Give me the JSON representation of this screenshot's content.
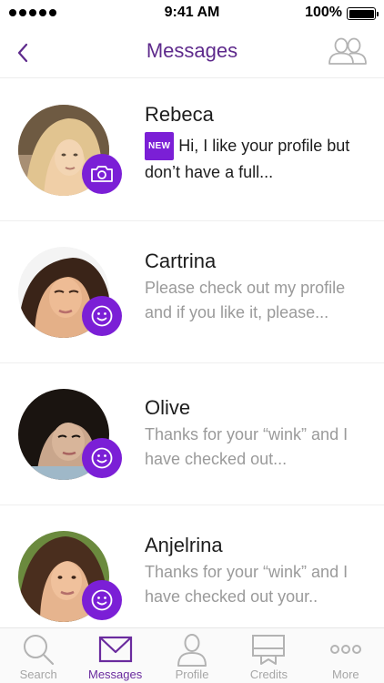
{
  "status_bar": {
    "time": "9:41 AM",
    "battery": "100%",
    "battery_level": 1.0
  },
  "nav": {
    "title": "Messages",
    "back_icon": "chevron-left-icon",
    "contacts_icon": "two-people-icon"
  },
  "colors": {
    "accent": "#5e2a8c",
    "badge": "#7b1fd6",
    "preview_text": "#9a9a9a",
    "tab_inactive": "#a6a6a6"
  },
  "messages": [
    {
      "name": "Rebeca",
      "new_label": "NEW",
      "preview": "Hi, I like your profile but don’t have a full...",
      "badge_icon": "camera-icon",
      "unread": true
    },
    {
      "name": "Cartrina",
      "preview": "Please check out my profile and if you like it, please...",
      "badge_icon": "smiley-icon",
      "unread": false
    },
    {
      "name": "Olive",
      "preview": "Thanks for your “wink” and I have checked out...",
      "badge_icon": "smiley-icon",
      "unread": false
    },
    {
      "name": "Anjelrina",
      "preview": "Thanks for your “wink” and I have checked out your..",
      "badge_icon": "smiley-icon",
      "unread": false
    }
  ],
  "tabs": [
    {
      "label": "Search",
      "icon": "search-icon",
      "active": false
    },
    {
      "label": "Messages",
      "icon": "envelope-icon",
      "active": true
    },
    {
      "label": "Profile",
      "icon": "person-icon",
      "active": false
    },
    {
      "label": "Credits",
      "icon": "credits-icon",
      "active": false
    },
    {
      "label": "More",
      "icon": "more-icon",
      "active": false
    }
  ]
}
